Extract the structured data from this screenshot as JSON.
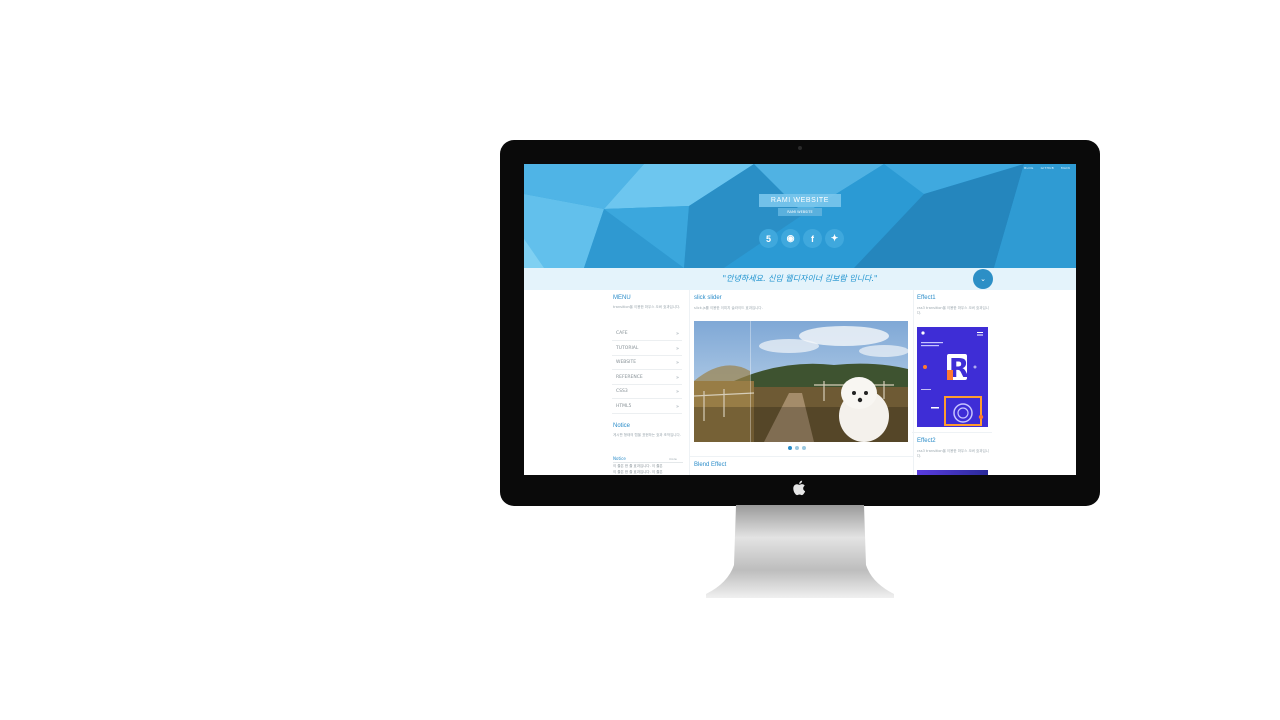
{
  "site": {
    "title": "RAMI WEBSITE",
    "subtitle": "RAMI WEBSITE",
    "topnav": [
      "BLOG",
      "GITHUB",
      "MAIN"
    ],
    "greeting": "\"안녕하세요. 신입 웹디자이너 김보람 입니다.\"",
    "socials": [
      {
        "icon": "html5-icon",
        "glyph": "5"
      },
      {
        "icon": "github-icon",
        "glyph": "◉"
      },
      {
        "icon": "facebook-icon",
        "glyph": "f"
      },
      {
        "icon": "twitter-icon",
        "glyph": "✦"
      }
    ],
    "colors": {
      "header": "#2b9bd5",
      "accent": "#2a8cc9",
      "greeting_bg": "#e4f3fb"
    }
  },
  "left": {
    "menu_title": "MENU",
    "menu_desc": "transition을 이용한 마우스 오버 효과입니다.",
    "menu_items": [
      "CAFE",
      "TUTORIAL",
      "WEBSITE",
      "REFERENCE",
      "CSS3",
      "HTML5"
    ],
    "notice_title": "Notice",
    "notice_desc": "게시판 형태의 탭을 표현하는 효과 조작입니다.",
    "notice_tab": "Notice",
    "notice_more": "more",
    "notice_lines": [
      "이 줄은 한 줄 효과입니다. 이 줄은",
      "이 줄은 한 줄 효과입니다. 이 줄은"
    ]
  },
  "middle": {
    "slider_title": "slick slider",
    "slider_desc": "slick.js를 이용한 이미지 슬라이드 효과입니다.",
    "slider_dots": 3,
    "slider_active": 0,
    "blend_title": "Blend Effect"
  },
  "right": {
    "effect1_title": "Effect1",
    "effect1_desc": "css3 transition을 이용한 마우스 오버 효과입니다.",
    "effect2_title": "Effect2",
    "effect2_desc": "css3 transition을 이용한 마우스 오버 효과입니다."
  }
}
